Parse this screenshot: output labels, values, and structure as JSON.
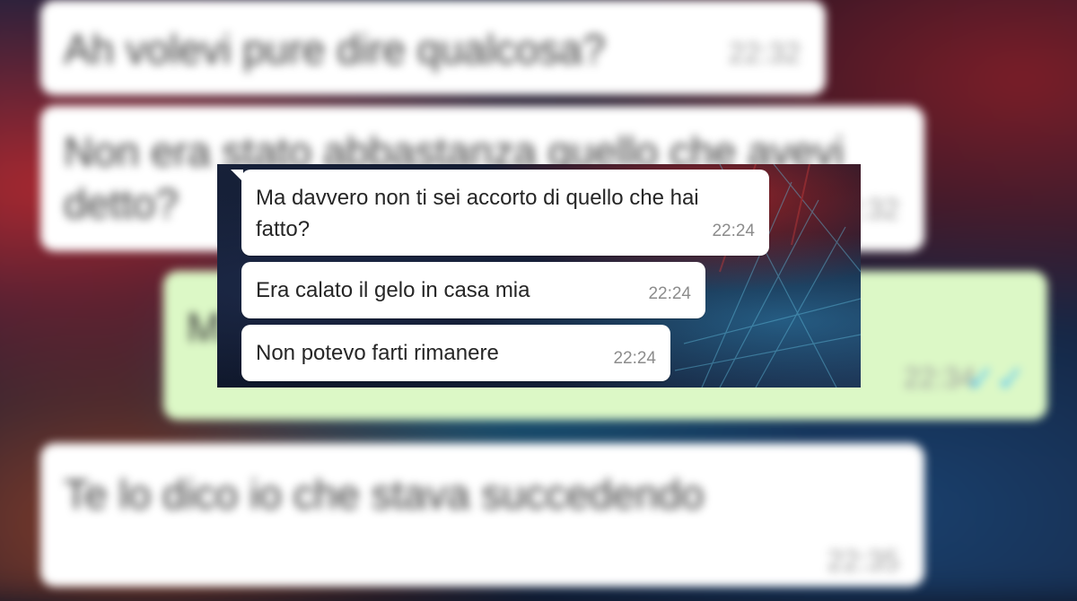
{
  "background_chat": {
    "messages": [
      {
        "text": "Ah volevi pure dire qualcosa?",
        "time": "22:32",
        "direction": "incoming"
      },
      {
        "text": "Non era stato abbastanza quello che avevi detto?",
        "time": "22:32",
        "direction": "incoming"
      },
      {
        "text": "M… endo",
        "time": "22:34",
        "direction": "outgoing"
      },
      {
        "text": "Te lo dico io che stava succedendo",
        "time": "22:35",
        "direction": "incoming"
      }
    ]
  },
  "card_chat": {
    "messages": [
      {
        "text": "Ma davvero non ti sei accorto di quello che hai fatto?",
        "time": "22:24",
        "direction": "incoming"
      },
      {
        "text": "Era calato il gelo in casa mia",
        "time": "22:24",
        "direction": "incoming"
      },
      {
        "text": "Non potevo farti rimanere",
        "time": "22:24",
        "direction": "incoming"
      }
    ]
  },
  "colors": {
    "incoming_bubble": "#ffffff",
    "outgoing_bubble": "#dcf8c6",
    "timestamp": "#8c8c8c",
    "read_check": "#4fc3f7"
  },
  "icons": {
    "read_receipt": "double-check-icon"
  }
}
